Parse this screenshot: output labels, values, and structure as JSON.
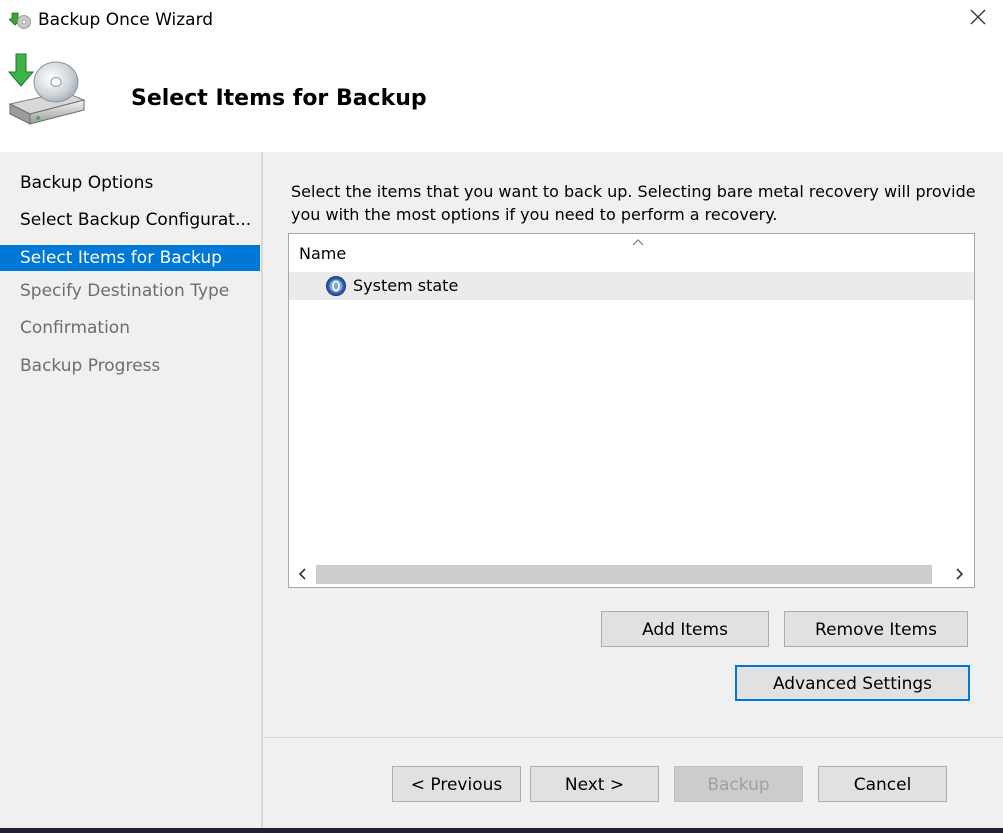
{
  "window": {
    "title": "Backup Once Wizard",
    "close_label": "Close"
  },
  "header": {
    "title": "Select Items for Backup"
  },
  "sidebar": {
    "items": [
      {
        "label": "Backup Options",
        "state": "done"
      },
      {
        "label": "Select Backup Configurat...",
        "state": "done"
      },
      {
        "label": "Select Items for Backup",
        "state": "active"
      },
      {
        "label": "Specify Destination Type",
        "state": "pending"
      },
      {
        "label": "Confirmation",
        "state": "pending"
      },
      {
        "label": "Backup Progress",
        "state": "pending"
      }
    ]
  },
  "main": {
    "instruction": "Select the items that you want to back up. Selecting bare metal recovery will provide you with the most options if you need to perform a recovery.",
    "list": {
      "column_header": "Name",
      "items": [
        {
          "label": "System state",
          "icon": "system-state-icon"
        }
      ]
    },
    "buttons": {
      "add_items": "Add Items",
      "remove_items": "Remove Items",
      "advanced_settings": "Advanced Settings"
    }
  },
  "footer": {
    "previous": "< Previous",
    "next": "Next >",
    "backup": "Backup",
    "cancel": "Cancel"
  },
  "colors": {
    "accent": "#0078d7",
    "panel_bg": "#f0f0f0",
    "pending_text": "#6d6d6d"
  }
}
